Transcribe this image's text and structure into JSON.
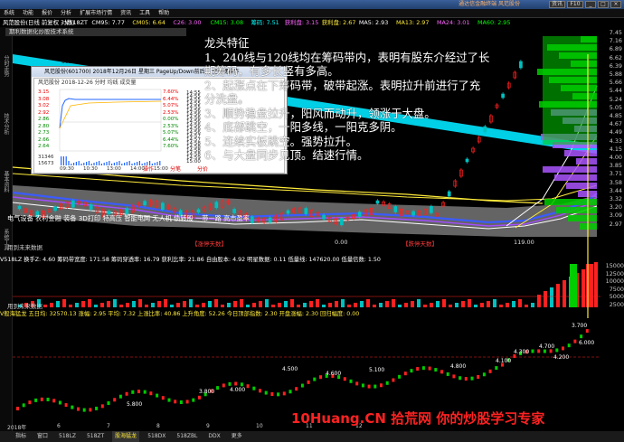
{
  "titlebar": {
    "brand": "通达信金融终端 风范股份"
  },
  "menu": [
    "系统",
    "功能",
    "报价",
    "分析",
    "扩展市场行情",
    "资讯",
    "工具",
    "帮助"
  ],
  "window_buttons": [
    "资讯",
    "F10",
    "_",
    "□",
    "×"
  ],
  "period_tabs": [
    "分时",
    "1分钟",
    "5分钟",
    "15分钟",
    "30分钟",
    "60分钟",
    "日线",
    "周线",
    "月线",
    "多周期",
    "更多"
  ],
  "left_toolbar": [
    "分时走势",
    "技术分析",
    "基本资料",
    "系统工具"
  ],
  "chart_header": {
    "stock": "风范股份(日线 前复权 对数)",
    "items": [
      {
        "label": "V518ZT",
        "color": "#ffffff"
      },
      {
        "label": "CM95: 7.77",
        "color": "#ffffff"
      },
      {
        "label": "CM05: 6.64",
        "color": "#ffeb3b"
      },
      {
        "label": "C26: 3.00",
        "color": "#ff66ff"
      },
      {
        "label": "CM15: 3.08",
        "color": "#00ff00"
      },
      {
        "label": "筹码: 7.51",
        "color": "#00ffff"
      },
      {
        "label": "获利盘: 3.15",
        "color": "#ff66ff"
      },
      {
        "label": "获利盘: 2.67",
        "color": "#ffeb3b"
      },
      {
        "label": "MA5: 2.93",
        "color": "#ffffff"
      },
      {
        "label": "MA13: 2.97",
        "color": "#ffeb3b"
      },
      {
        "label": "MA24: 3.01",
        "color": "#ff66ff"
      },
      {
        "label": "MA60: 2.95",
        "color": "#00ff00"
      }
    ]
  },
  "subheader": "期利数据化炒股技术系统",
  "price_axis": [
    "7.45",
    "7.16",
    "6.89",
    "6.62",
    "6.39",
    "5.88",
    "5.66",
    "5.44",
    "5.24",
    "5.05",
    "4.85",
    "4.67",
    "4.49",
    "4.33",
    "4.15",
    "4.00",
    "3.85",
    "3.71",
    "3.58",
    "3.44",
    "3.32",
    "3.20",
    "3.09",
    "2.97"
  ],
  "notes": {
    "title": "龙头特征",
    "lines": [
      "1、240线与120线均在筹码带内，表明有股东介经过了长",
      "期筹码，有多长竖有多高。",
      "2、起涨点在下筹码带，破带起涨。表明拉升前进行了充",
      "分洗盘。",
      "3、顺势稳盘拉升，阳风而动升，领涨于大盘。",
      "4、底部跳空，一阳多线，一阳克多阴。",
      "5、连续实板跳空。强势拉升。",
      "6、与大盘同步见顶。结速行情。"
    ]
  },
  "popup": {
    "title": "风范股份(601700) 2018年12月26日 星期三 PageUp/Down前后日 空格键操作",
    "subtitle": "风范股份  2018-12-26  分时  均线  成交量",
    "left_axis": [
      "3.15",
      "3.08",
      "3.02",
      "2.92",
      "2.86",
      "2.80",
      "2.73",
      "2.66",
      "2.64"
    ],
    "right_axis": [
      "7.60%",
      "6.44%",
      "5.07%",
      "2.53%",
      "0.00%",
      "2.53%",
      "5.07%",
      "6.44%",
      "7.60%"
    ],
    "vol_axis": [
      "31346",
      "15673"
    ],
    "list": [
      "14:55",
      "14:55",
      "14:55",
      "14:55",
      "14:55",
      "14:56",
      "14:56",
      "14:56",
      "14:56",
      "14:56",
      "14:56",
      "14:56",
      "14:57",
      "14:57",
      "14:58",
      "14:58",
      "14:58",
      "14:58",
      "14:59",
      "15:00"
    ],
    "times": [
      "09:30",
      "10:30",
      "13:00",
      "14:00",
      "15:00"
    ],
    "foot": [
      "操作",
      "分笔",
      "分价"
    ],
    "code": "601700",
    "name": "风范股份"
  },
  "sectors": "电气设备 农村金融 装备 3D打印 特高压 智能电网 无人机 债转股 一带一路 高市盈率",
  "red_tags": [
    "【涨停天数】",
    "【跌停天数】"
  ],
  "zero_value": "0.00",
  "bottom_value": "119.00",
  "left_note": "用到未来数据",
  "v518_header": "V518LZ  换手Z: 4.60   筹码带宽度: 171.58  筹码穿透率: 16.79  获利比率: 21.86  自由股本: 4.92  明星数据: 0.11  低量线: 147620.00  低量信数: 1.50",
  "v518_axis": [
    "15000",
    "12500",
    "10000",
    "7500",
    "5000",
    "2500"
  ],
  "v518_label": "用到未来数据",
  "bottom_header": "V般海猛龙  五日均: 32570.13  涨幅: 2.95  平均: 7.32  上涨比率: 40.86      上升角度: 52.26  今日顶部指数: 2.30  开盘涨幅: 2.30  回归幅度: 0.00",
  "bottom_labels": [
    "3.700",
    "4.700",
    "4.800",
    "4.500",
    "5.100",
    "4.600",
    "3.800",
    "4.000",
    "5.800",
    "4.300",
    "4.200",
    "4.100",
    "6.000"
  ],
  "x_axis": [
    "2018年",
    "6",
    "7",
    "8",
    "9",
    "10",
    "11",
    "12"
  ],
  "bottom_tabs": [
    "指标",
    "窗口",
    "518LZ",
    "518ZT",
    "股海猛龙",
    "518DX",
    "518ZBL",
    "DDX",
    "更多"
  ],
  "watermark": "10Huang.CN 拾荒网 你的炒股学习专家",
  "colors": {
    "up": "#ff2020",
    "down": "#00c0c0",
    "ma_yellow": "#ffeb3b",
    "ma_white": "#ffffff"
  }
}
